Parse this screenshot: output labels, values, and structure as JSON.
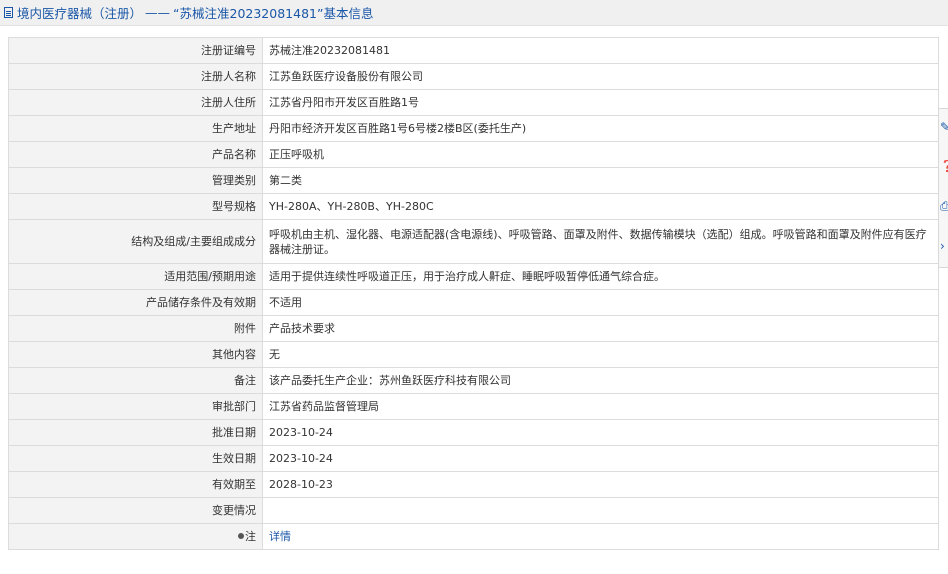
{
  "header": {
    "section": "境内医疗器械（注册）",
    "separator": "——",
    "title": "“苏械注准20232081481”基本信息"
  },
  "rows": [
    {
      "label": "注册证编号",
      "value": "苏械注准20232081481"
    },
    {
      "label": "注册人名称",
      "value": "江苏鱼跃医疗设备股份有限公司"
    },
    {
      "label": "注册人住所",
      "value": "江苏省丹阳市开发区百胜路1号"
    },
    {
      "label": "生产地址",
      "value": "丹阳市经济开发区百胜路1号6号楼2楼B区(委托生产)"
    },
    {
      "label": "产品名称",
      "value": "正压呼吸机"
    },
    {
      "label": "管理类别",
      "value": "第二类"
    },
    {
      "label": "型号规格",
      "value": "YH-280A、YH-280B、YH-280C"
    },
    {
      "label": "结构及组成/主要组成成分",
      "value": "呼吸机由主机、湿化器、电源适配器(含电源线)、呼吸管路、面罩及附件、数据传输模块（选配）组成。呼吸管路和面罩及附件应有医疗器械注册证。"
    },
    {
      "label": "适用范围/预期用途",
      "value": "适用于提供连续性呼吸道正压，用于治疗成人鼾症、睡眠呼吸暂停低通气综合症。"
    },
    {
      "label": "产品储存条件及有效期",
      "value": "不适用"
    },
    {
      "label": "附件",
      "value": "产品技术要求"
    },
    {
      "label": "其他内容",
      "value": "无"
    },
    {
      "label": "备注",
      "value": "该产品委托生产企业：苏州鱼跃医疗科技有限公司"
    },
    {
      "label": "审批部门",
      "value": "江苏省药品监督管理局"
    },
    {
      "label": "批准日期",
      "value": "2023-10-24"
    },
    {
      "label": "生效日期",
      "value": "2023-10-24"
    },
    {
      "label": "有效期至",
      "value": "2028-10-23"
    },
    {
      "label": "变更情况",
      "value": ""
    },
    {
      "label": "注",
      "value": "详情",
      "icon": "bulb-icon"
    }
  ],
  "side_panel": {
    "icons": [
      "edit-icon",
      "help-icon",
      "print-icon",
      "chevron-right-icon"
    ],
    "accent_color": "#1a57a8"
  },
  "colors": {
    "link": "#1a57a8",
    "label_bg": "#f3f3f3",
    "border": "#dcdcdc"
  }
}
